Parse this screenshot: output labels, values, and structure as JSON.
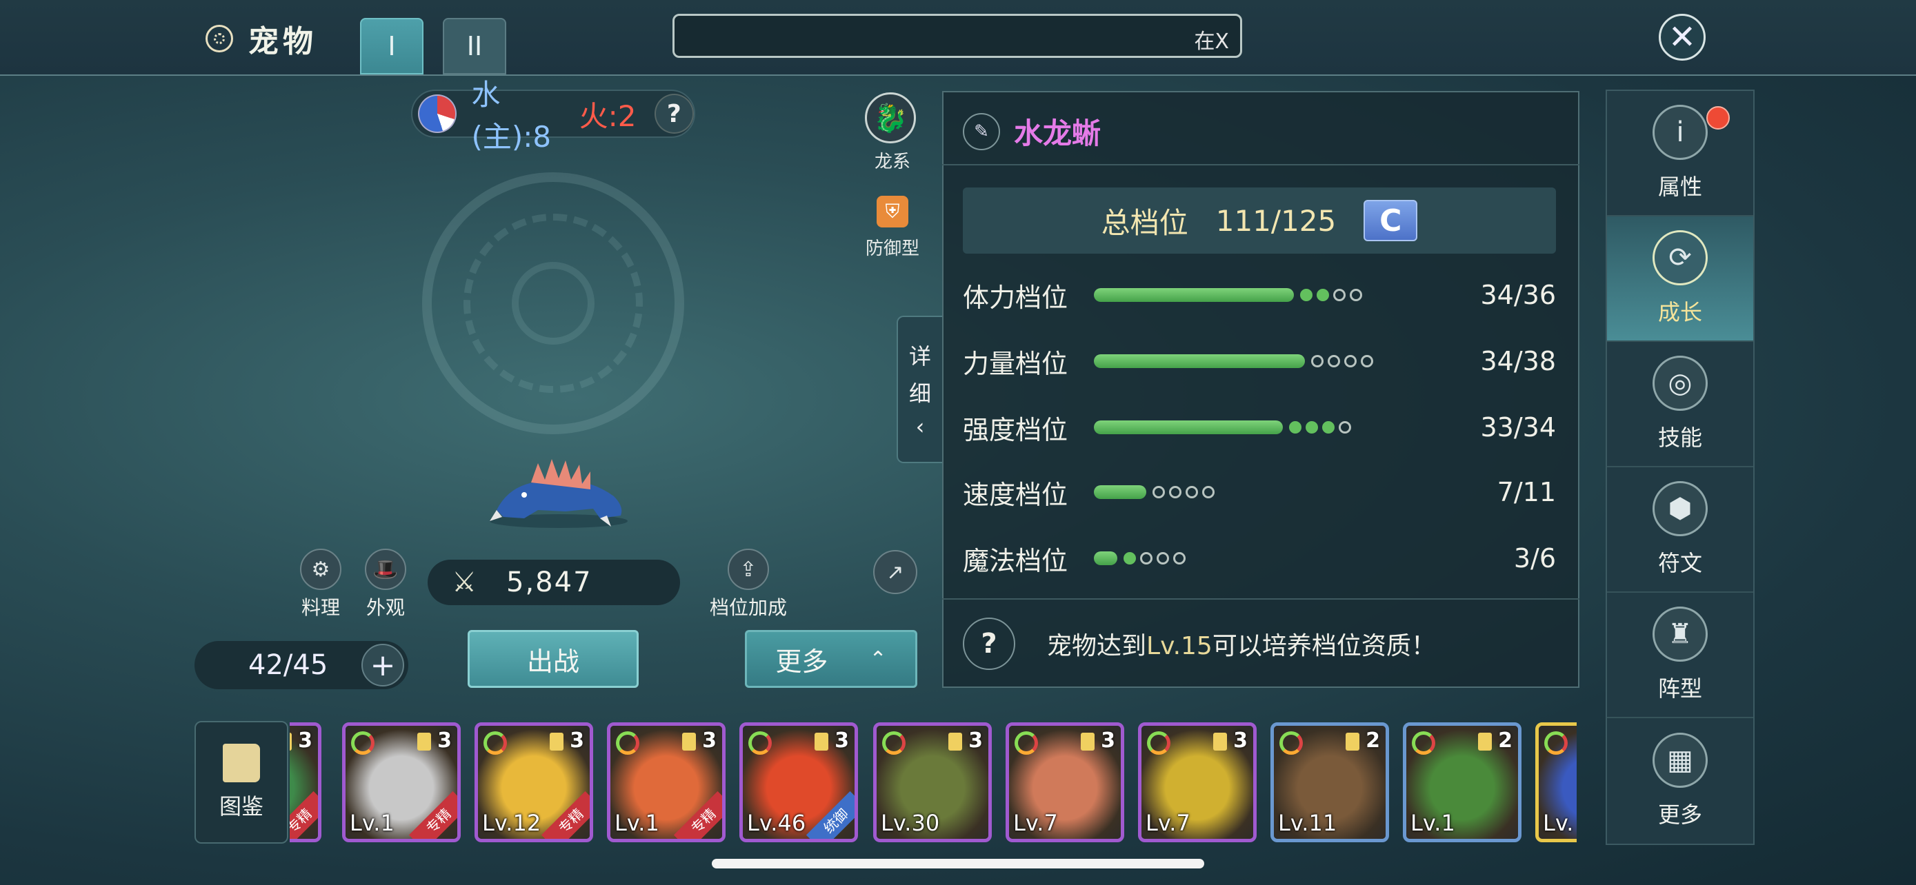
{
  "header": {
    "title": "宠物",
    "tabs": [
      {
        "label": "I",
        "active": true
      },
      {
        "label": "II",
        "active": false
      }
    ],
    "search_text": "在X",
    "close_icon": "close-icon"
  },
  "element": {
    "water_text": "水(主):8",
    "fire_text": "火:2",
    "help": "?"
  },
  "pet_type": {
    "family_label": "龙系",
    "role_label": "防御型"
  },
  "detail_tab": {
    "line1": "详",
    "line2": "细",
    "arrow": "‹"
  },
  "actions": {
    "cook_label": "料理",
    "appearance_label": "外观",
    "power_value": "5,847",
    "grade_bonus_label": "档位加成"
  },
  "capacity": {
    "value": "42/45",
    "plus": "+"
  },
  "buttons": {
    "battle": "出战",
    "more": "更多"
  },
  "stats": {
    "pet_name": "水龙蜥",
    "total_label": "总档位",
    "total_value": "111/125",
    "grade": "C",
    "rows": [
      {
        "label": "体力档位",
        "value": "34/36",
        "fill": 0.84,
        "on": 2,
        "off": 2
      },
      {
        "label": "力量档位",
        "value": "34/38",
        "fill": 0.84,
        "on": 0,
        "off": 4
      },
      {
        "label": "强度档位",
        "value": "33/34",
        "fill": 0.8,
        "on": 3,
        "off": 1
      },
      {
        "label": "速度档位",
        "value": "7/11",
        "fill": 0.21,
        "on": 0,
        "off": 4
      },
      {
        "label": "魔法档位",
        "value": "3/6",
        "fill": 0.1,
        "on": 1,
        "off": 4
      }
    ],
    "hint_prefix": "宠物达到",
    "hint_level": "Lv.15",
    "hint_suffix": "可以培养档位资质！"
  },
  "sidebar": {
    "items": [
      {
        "label": "属性",
        "icon": "info-icon",
        "badge": true
      },
      {
        "label": "成长",
        "icon": "growth-icon",
        "active": true
      },
      {
        "label": "技能",
        "icon": "skill-icon"
      },
      {
        "label": "符文",
        "icon": "rune-icon"
      },
      {
        "label": "阵型",
        "icon": "formation-icon"
      },
      {
        "label": "更多",
        "icon": "grid-icon"
      }
    ]
  },
  "bestiary": {
    "label": "图鉴"
  },
  "pets": [
    {
      "level": "",
      "count": "3",
      "tag": "专精",
      "color": "#3e8a4a",
      "border": "purple"
    },
    {
      "level": "Lv.1",
      "count": "3",
      "tag": "专精",
      "color": "#c8c8c8",
      "border": "purple"
    },
    {
      "level": "Lv.12",
      "count": "3",
      "tag": "专精",
      "color": "#e8b83a",
      "border": "purple"
    },
    {
      "level": "Lv.1",
      "count": "3",
      "tag": "专精",
      "color": "#e06a3a",
      "border": "purple"
    },
    {
      "level": "Lv.46",
      "count": "3",
      "tag": "统御",
      "color": "#e04a2a",
      "border": "purple"
    },
    {
      "level": "Lv.30",
      "count": "3",
      "tag": "",
      "color": "#6a7a3a",
      "border": "purple"
    },
    {
      "level": "Lv.7",
      "count": "3",
      "tag": "",
      "color": "#d07a5a",
      "border": "purple"
    },
    {
      "level": "Lv.7",
      "count": "3",
      "tag": "",
      "color": "#d0b030",
      "border": "purple"
    },
    {
      "level": "Lv.11",
      "count": "2",
      "tag": "",
      "color": "#7a5a3a",
      "border": "blue"
    },
    {
      "level": "Lv.1",
      "count": "2",
      "tag": "",
      "color": "#4a8a3a",
      "border": "blue"
    },
    {
      "level": "Lv.",
      "count": "",
      "tag": "",
      "color": "#3a5ac0",
      "border": "gold"
    }
  ]
}
